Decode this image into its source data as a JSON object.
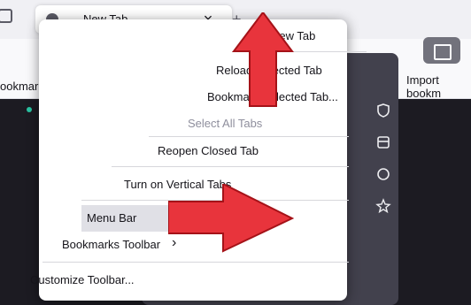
{
  "browser": {
    "tab_title": "New Tab",
    "tab_close": "×",
    "new_tab_icon": "+",
    "back_icon": "←",
    "forward_icon": "→",
    "reload_icon": "↻",
    "bookmark_item": "ookmarks...",
    "import_bookmarks": "Import bookm"
  },
  "menu": {
    "items": [
      {
        "label": "New Tab",
        "disabled": false
      },
      {
        "label": "Reload Selected Tab",
        "disabled": false
      },
      {
        "label": "Bookmark Selected Tab...",
        "disabled": false
      },
      {
        "label": "Select All Tabs",
        "disabled": true
      },
      {
        "label": "Reopen Closed Tab",
        "disabled": false
      },
      {
        "label": "Turn on Vertical Tabs",
        "disabled": false
      },
      {
        "label": "Menu Bar",
        "disabled": false,
        "active": true
      },
      {
        "label": "Bookmarks Toolbar",
        "disabled": false,
        "submenu": true
      },
      {
        "label": "Customize Toolbar...",
        "disabled": false
      }
    ],
    "submenu_chevron": "›"
  },
  "side_icons": [
    "shield-icon",
    "box-icon",
    "sync-icon",
    "star-icon"
  ],
  "colors": {
    "arrow_red": "#e8343c",
    "arrow_dark_red": "#a51218",
    "menu_bg": "#ffffff",
    "content_bg": "#1c1b22"
  }
}
